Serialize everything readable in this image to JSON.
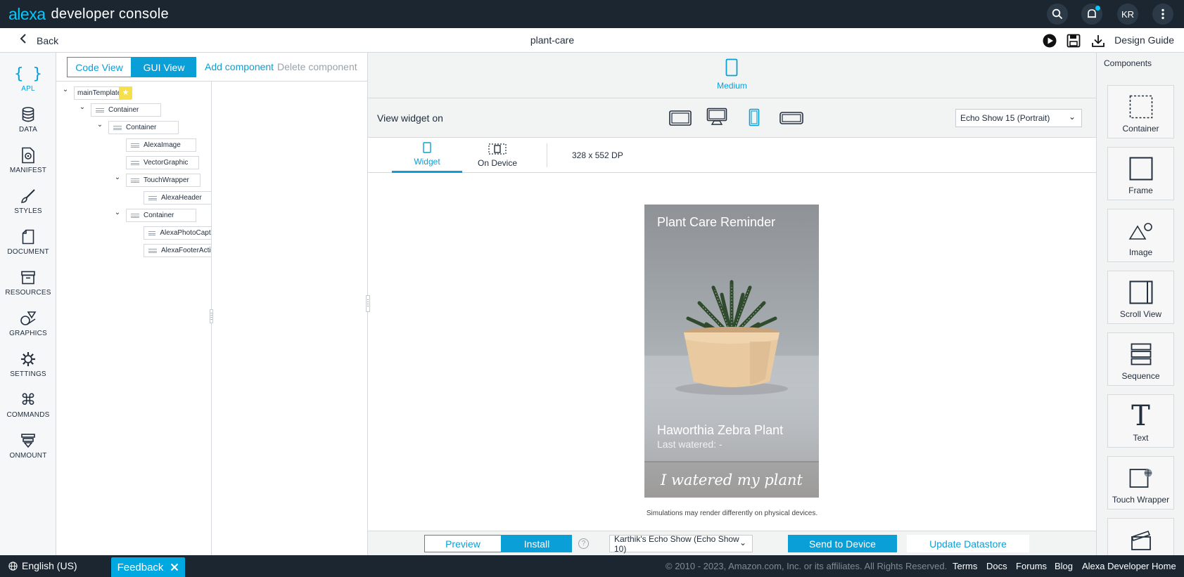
{
  "app": {
    "logo_brand": "alexa",
    "logo_product": "developer console",
    "avatar_initials": "KR"
  },
  "subbar": {
    "back_label": "Back",
    "project_title": "plant-care",
    "design_guide_label": "Design Guide"
  },
  "rail": {
    "items": [
      {
        "label": "APL",
        "icon": "braces-icon"
      },
      {
        "label": "DATA",
        "icon": "database-icon"
      },
      {
        "label": "MANIFEST",
        "icon": "manifest-icon"
      },
      {
        "label": "STYLES",
        "icon": "brush-icon"
      },
      {
        "label": "DOCUMENT",
        "icon": "document-icon"
      },
      {
        "label": "RESOURCES",
        "icon": "archive-icon"
      },
      {
        "label": "GRAPHICS",
        "icon": "shapes-icon"
      },
      {
        "label": "SETTINGS",
        "icon": "gear-icon"
      },
      {
        "label": "COMMANDS",
        "icon": "command-icon"
      },
      {
        "label": "ONMOUNT",
        "icon": "layers-icon"
      }
    ]
  },
  "editor": {
    "code_view_label": "Code View",
    "gui_view_label": "GUI View",
    "add_component_label": "Add component",
    "delete_component_label": "Delete component"
  },
  "tree": {
    "nodes": [
      {
        "label": "mainTemplate"
      },
      {
        "label": "Container"
      },
      {
        "label": "Container"
      },
      {
        "label": "AlexaImage"
      },
      {
        "label": "VectorGraphic"
      },
      {
        "label": "TouchWrapper"
      },
      {
        "label": "AlexaHeader"
      },
      {
        "label": "Container"
      },
      {
        "label": "AlexaPhotoCaption"
      },
      {
        "label": "AlexaFooterAction"
      }
    ]
  },
  "preview": {
    "size_label": "Medium",
    "view_widget_label": "View widget on",
    "device_select": "Echo Show 15 (Portrait)",
    "tabs": [
      {
        "label": "Widget"
      },
      {
        "label": "On Device"
      }
    ],
    "dimensions": "328 x 552 DP",
    "widget": {
      "title": "Plant Care Reminder",
      "plant_name": "Haworthia Zebra Plant",
      "last_watered": "Last watered: -",
      "action": "I watered my plant"
    },
    "simulation_note": "Simulations may render differently on physical devices."
  },
  "actions": {
    "preview_label": "Preview",
    "install_label": "Install",
    "help_glyph": "?",
    "target_device": "Karthik's Echo Show (Echo Show 10)",
    "send_label": "Send to Device",
    "update_label": "Update Datastore"
  },
  "palette": {
    "title": "Components",
    "items": [
      {
        "label": "Container"
      },
      {
        "label": "Frame"
      },
      {
        "label": "Image"
      },
      {
        "label": "Scroll View"
      },
      {
        "label": "Sequence"
      },
      {
        "label": "Text"
      },
      {
        "label": "Touch Wrapper"
      }
    ],
    "text_glyph": "T"
  },
  "footer": {
    "language": "English (US)",
    "feedback_label": "Feedback",
    "copyright": "© 2010 - 2023, Amazon.com, Inc. or its affiliates. All Rights Reserved.",
    "links": [
      "Terms",
      "Docs",
      "Forums",
      "Blog",
      "Alexa Developer Home"
    ]
  },
  "colors": {
    "accent": "#0a9fd6",
    "topbar": "#1b2631",
    "notification_dot": "#00caff"
  }
}
